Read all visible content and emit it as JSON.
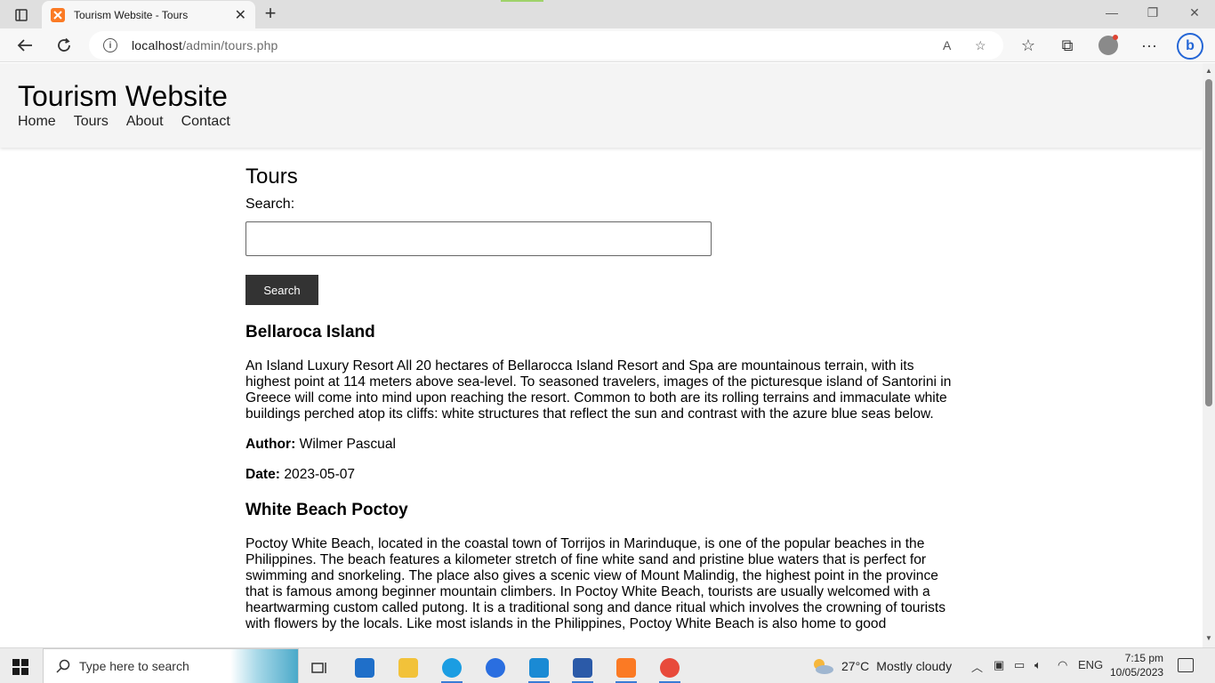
{
  "browser": {
    "tab_title": "Tourism Website - Tours",
    "tab_close": "✕",
    "new_tab": "+",
    "url_host": "localhost",
    "url_path": "/admin/tours.php",
    "window_controls": [
      "—",
      "❐",
      "✕"
    ]
  },
  "site": {
    "title": "Tourism Website",
    "nav": [
      "Home",
      "Tours",
      "About",
      "Contact"
    ]
  },
  "page": {
    "heading": "Tours",
    "search_label": "Search:",
    "search_value": "",
    "search_button": "Search"
  },
  "tours": [
    {
      "title": "Bellaroca Island",
      "description": "An Island Luxury Resort All 20 hectares of Bellarocca Island Resort and Spa are mountainous terrain, with its highest point at 114 meters above sea-level. To seasoned travelers, images of the picturesque island of Santorini in Greece will come into mind upon reaching the resort. Common to both are its rolling terrains and immaculate white buildings perched atop its cliffs: white structures that reflect the sun and contrast with the azure blue seas below.",
      "author_label": "Author:",
      "author": "Wilmer Pascual",
      "date_label": "Date:",
      "date": "2023-05-07"
    },
    {
      "title": "White Beach Poctoy",
      "description": "Poctoy White Beach, located in the coastal town of Torrijos in Marinduque, is one of the popular beaches in the Philippines. The beach features a kilometer stretch of fine white sand and pristine blue waters that is perfect for swimming and snorkeling. The place also gives a scenic view of Mount Malindig, the highest point in the province that is famous among beginner mountain climbers. In Poctoy White Beach, tourists are usually welcomed with a heartwarming custom called putong. It is a traditional song and dance ritual which involves the crowning of tourists with flowers by the locals. Like most islands in the Philippines, Poctoy White Beach is also home to good"
    }
  ],
  "taskbar": {
    "search_placeholder": "Type here to search",
    "weather_temp": "27°C",
    "weather_text": "Mostly cloudy",
    "language": "ENG",
    "time": "7:15 pm",
    "date": "10/05/2023"
  },
  "colors": {
    "header_bg": "#f4f4f4",
    "button_bg": "#333333",
    "tab_favicon": "#fb7a24"
  }
}
